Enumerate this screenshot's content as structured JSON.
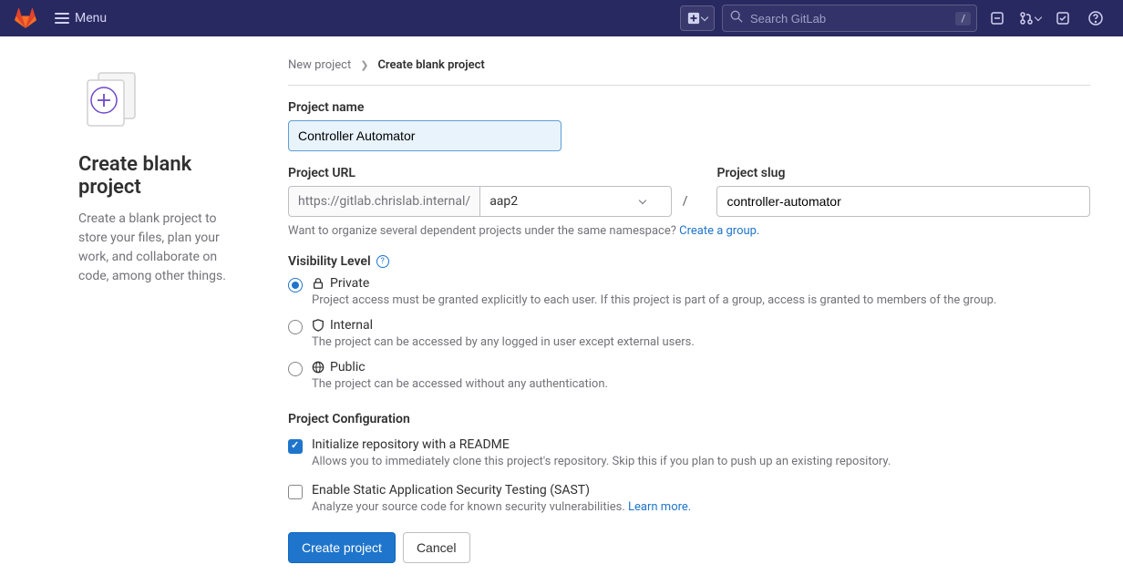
{
  "header": {
    "menu_label": "Menu",
    "search_placeholder": "Search GitLab",
    "kbd_hint": "/"
  },
  "sidebar": {
    "title": "Create blank project",
    "description": "Create a blank project to store your files, plan your work, and collaborate on code, among other things."
  },
  "breadcrumb": {
    "parent": "New project",
    "current": "Create blank project"
  },
  "form": {
    "project_name_label": "Project name",
    "project_name_value": "Controller Automator",
    "project_url_label": "Project URL",
    "project_url_prefix": "https://gitlab.chrislab.internal/",
    "project_url_namespace": "aap2",
    "url_separator": "/",
    "project_slug_label": "Project slug",
    "project_slug_value": "controller-automator",
    "namespace_help_text": "Want to organize several dependent projects under the same namespace? ",
    "namespace_help_link": "Create a group.",
    "visibility_label": "Visibility Level",
    "visibility": {
      "private": {
        "label": "Private",
        "desc": "Project access must be granted explicitly to each user. If this project is part of a group, access is granted to members of the group."
      },
      "internal": {
        "label": "Internal",
        "desc": "The project can be accessed by any logged in user except external users."
      },
      "public": {
        "label": "Public",
        "desc": "The project can be accessed without any authentication."
      }
    },
    "config_label": "Project Configuration",
    "readme": {
      "label": "Initialize repository with a README",
      "desc": "Allows you to immediately clone this project's repository. Skip this if you plan to push up an existing repository."
    },
    "sast": {
      "label": "Enable Static Application Security Testing (SAST)",
      "desc": "Analyze your source code for known security vulnerabilities. ",
      "link": "Learn more."
    },
    "create_btn": "Create project",
    "cancel_btn": "Cancel"
  }
}
